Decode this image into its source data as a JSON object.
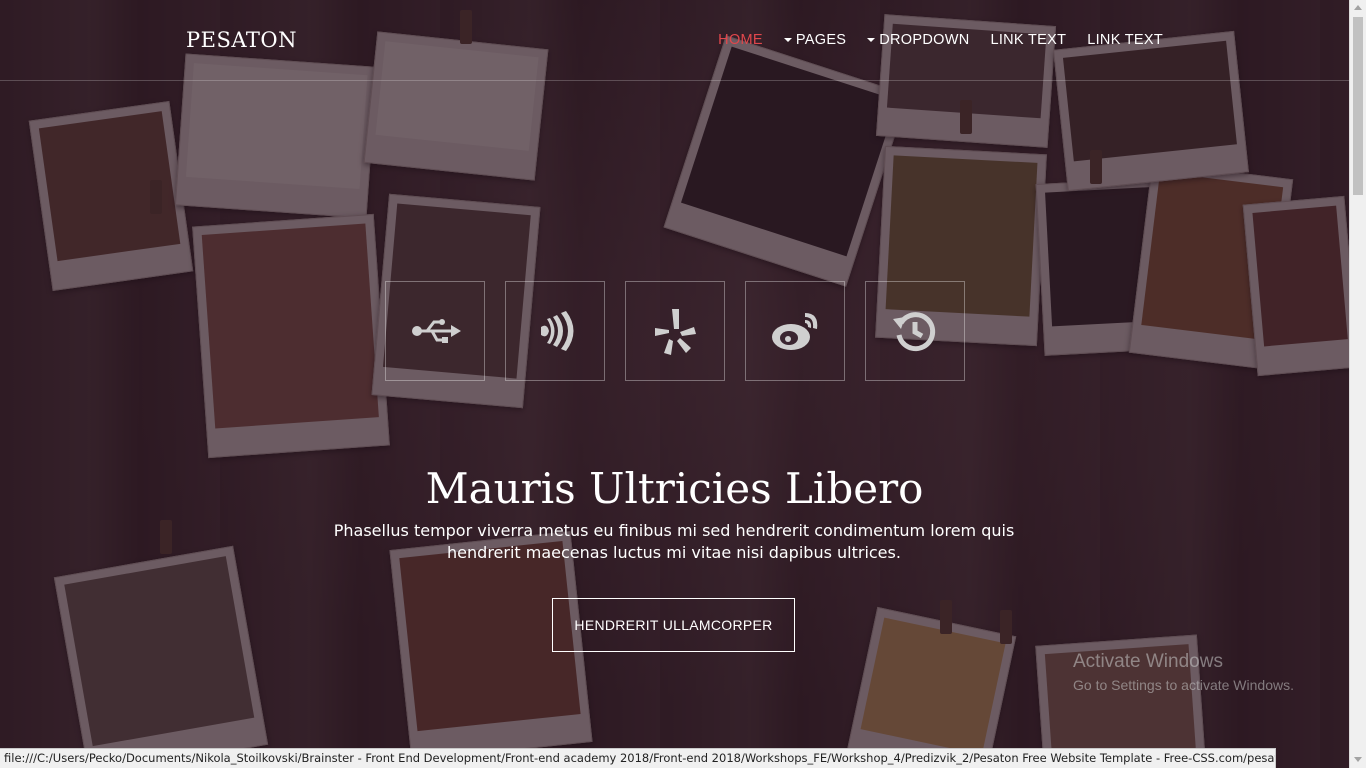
{
  "brand": "PESATON",
  "nav": {
    "home": "HOME",
    "pages": "PAGES",
    "dropdown": "DROPDOWN",
    "link1": "LINK TEXT",
    "link2": "LINK TEXT"
  },
  "icons": [
    "usb-icon",
    "signal-icon",
    "yelp-icon",
    "weibo-icon",
    "history-icon"
  ],
  "hero": {
    "title": "Mauris Ultricies Libero",
    "subtitle": "Phasellus tempor viverra metus eu finibus mi sed hendrerit condimentum lorem quis hendrerit maecenas luctus mi vitae nisi dapibus ultrices.",
    "button": "HENDRERIT ULLAMCORPER"
  },
  "watermark": {
    "title": "Activate Windows",
    "subtitle": "Go to Settings to activate Windows."
  },
  "status_url": "file:///C:/Users/Pecko/Documents/Nikola_Stoilkovski/Brainster - Front End Development/Front-end academy 2018/Front-end 2018/Workshops_FE/Workshop_4/Predizvik_2/Pesaton Free Website Template - Free-CSS.com/pesaton/index.html#",
  "colors": {
    "accent": "#e0474c",
    "overlay": "#28121e"
  }
}
